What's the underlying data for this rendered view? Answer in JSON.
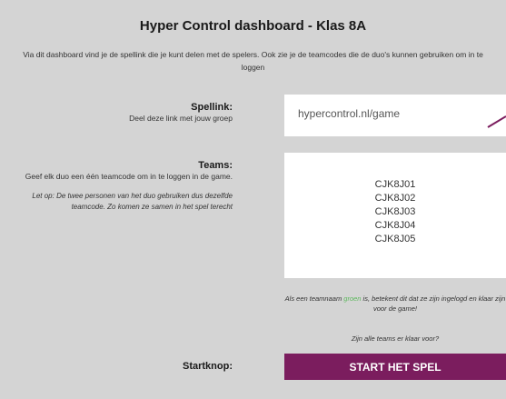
{
  "title": "Hyper Control dashboard - Klas 8A",
  "intro": "Via dit dashboard vind je de spellink die je kunt delen met de spelers. Ook zie je de teamcodes die de duo's kunnen gebruiken om in te loggen",
  "spellink": {
    "label": "Spellink:",
    "sub": "Deel deze link met jouw groep",
    "url": "hypercontrol.nl/game"
  },
  "teams": {
    "label": "Teams:",
    "sub": "Geef elk duo een één teamcode om in te loggen in de game.",
    "note": "Let op: De twee personen van het duo gebruiken dus dezelfde teamcode. Zo komen ze samen in het spel terecht",
    "codes": [
      "CJK8J01",
      "CJK8J02",
      "CJK8J03",
      "CJK8J04",
      "CJK8J05"
    ]
  },
  "status": {
    "part1": "Als een teamnaam ",
    "green_word": "groen",
    "part2": " is, betekent dit dat ze zijn ingelogd en klaar zijn voor de game!",
    "ready_question": "Zijn alle teams er klaar voor?"
  },
  "start": {
    "label": "Startknop:",
    "button": "START HET SPEL"
  },
  "colors": {
    "background": "#d4d4d4",
    "button": "#7b1d5e",
    "green": "#5cb85c"
  }
}
